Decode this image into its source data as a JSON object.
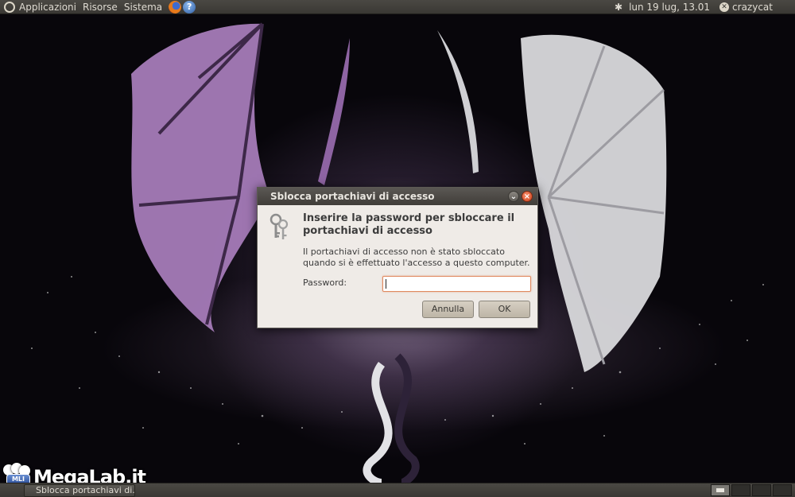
{
  "top_panel": {
    "menus": [
      "Applicazioni",
      "Risorse",
      "Sistema"
    ],
    "launchers": [
      "firefox-icon",
      "help-icon"
    ],
    "clock": "lun 19 lug, 13.01",
    "user": "crazycat",
    "bluetooth_icon": "bluetooth-icon"
  },
  "dialog": {
    "title": "Sblocca portachiavi di accesso",
    "heading": "Inserire la password per sbloccare il portachiavi di accesso",
    "message": "Il portachiavi di accesso non è stato sbloccato quando si è effettuato l'accesso a questo computer.",
    "password_label": "Password:",
    "password_value": "",
    "cancel_label": "Annulla",
    "ok_label": "OK",
    "icon": "keys-icon"
  },
  "bottom_panel": {
    "task_label": "Sblocca portachiavi di..."
  },
  "watermark": {
    "badge_text": "MLI",
    "text": "MegaLab.it"
  },
  "colors": {
    "panel": "#3a3834",
    "dialog_bg": "#efebe7",
    "titlebar": "#4a4743",
    "focus_border": "#e0895f",
    "close_button": "#d2431c"
  }
}
